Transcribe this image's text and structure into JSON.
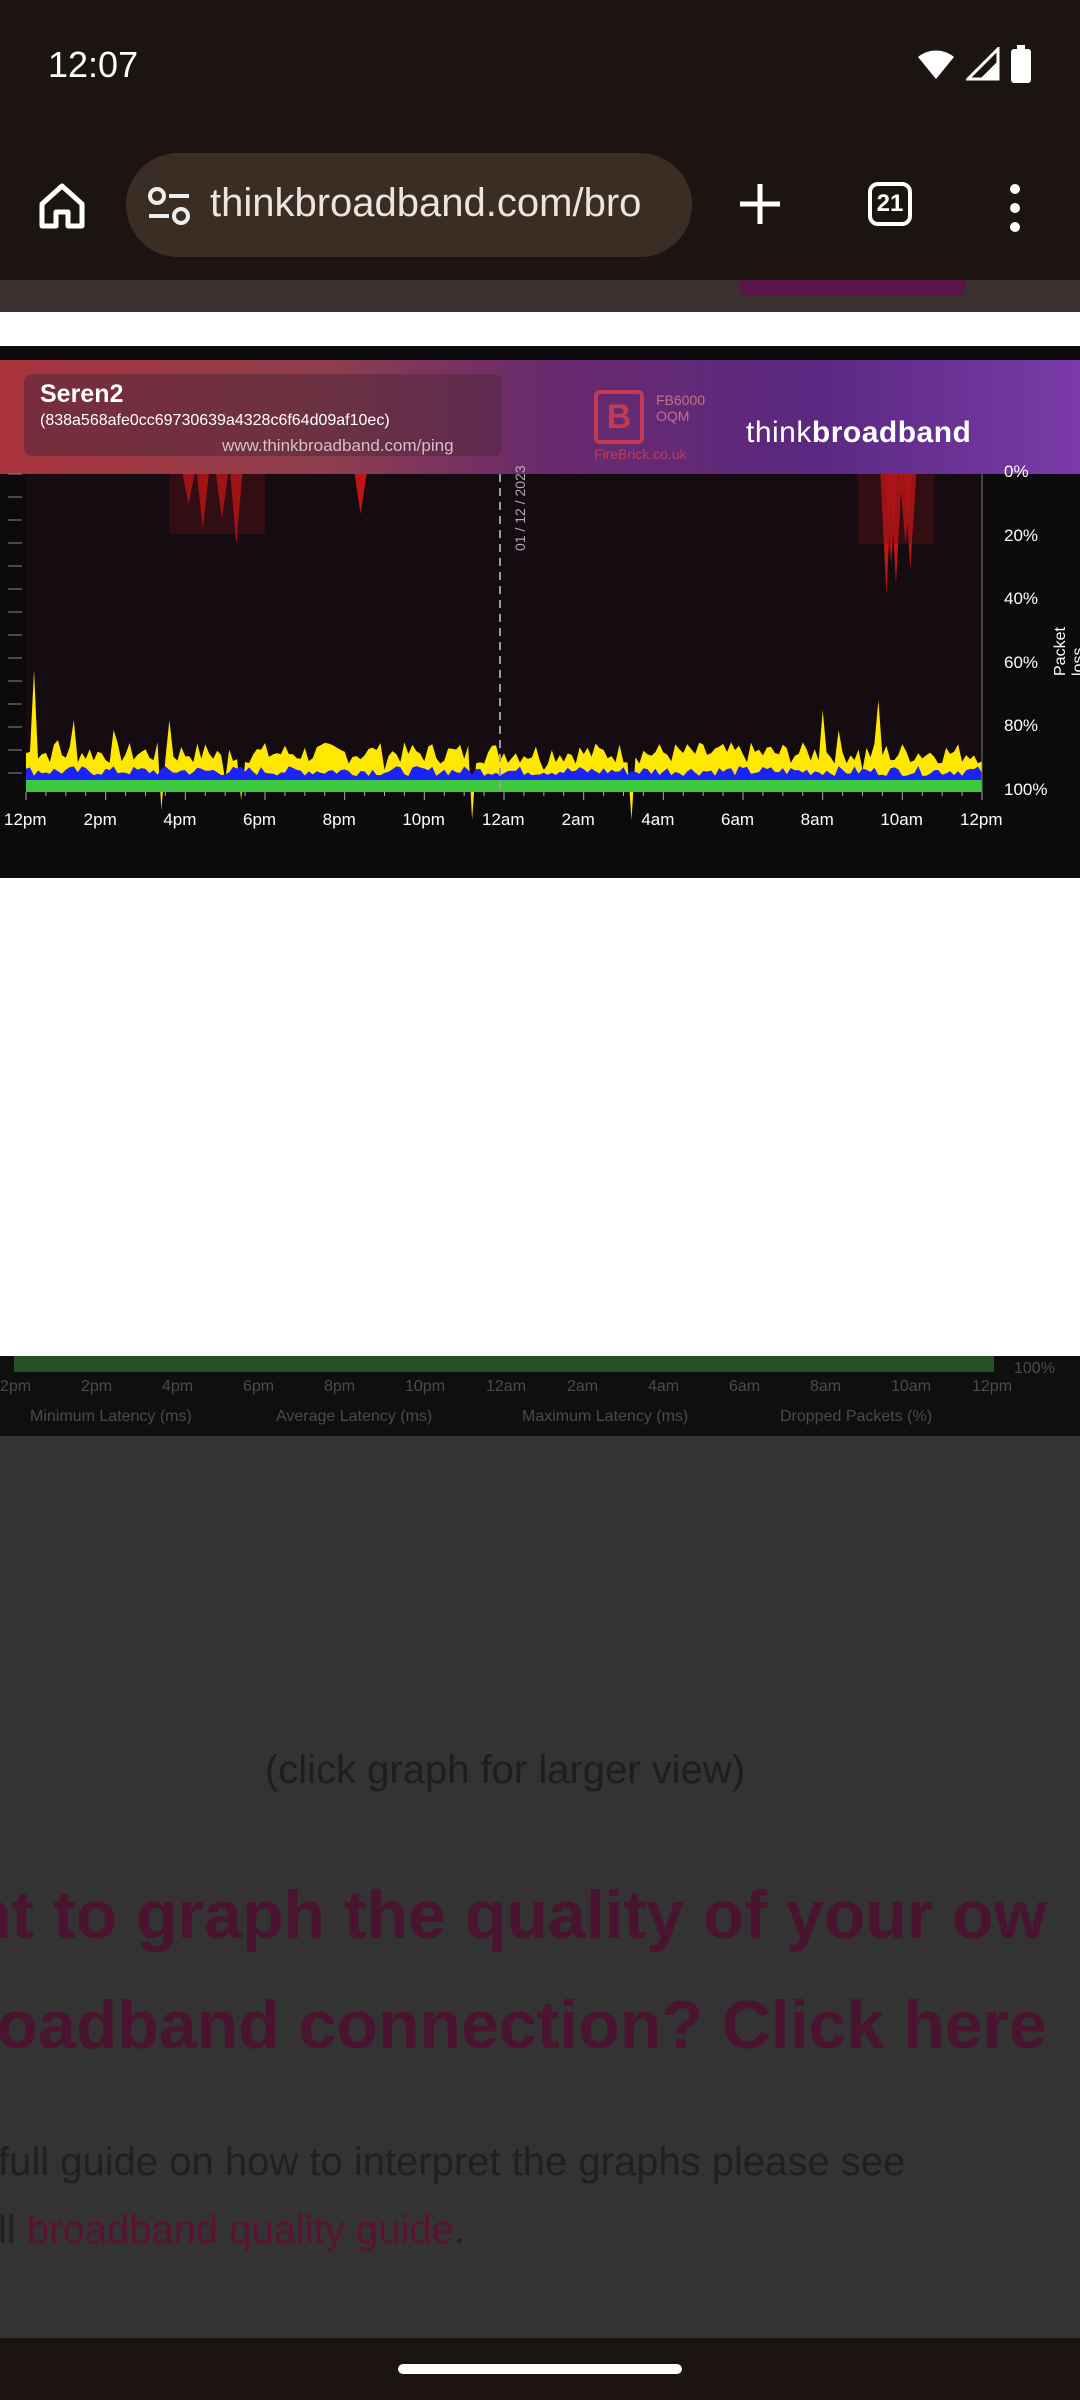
{
  "status": {
    "time": "12:07"
  },
  "browser": {
    "url": "thinkbroadband.com/bro",
    "tab_count": "21"
  },
  "graph": {
    "title": "Seren2",
    "id": "(838a568afe0cc69730639a4328c6f64d09af10ec)",
    "site": "www.thinkbroadband.com/ping",
    "firebrick_line1": "FB6000",
    "firebrick_line2": "OQM",
    "firebrick_site": "FireBrick.co.uk",
    "brand_prefix": "think",
    "brand_suffix": "broadband",
    "date": "01 / 12 / 2023",
    "x_ticks": [
      "12pm",
      "2pm",
      "4pm",
      "6pm",
      "8pm",
      "10pm",
      "12am",
      "2am",
      "4am",
      "6am",
      "8am",
      "10am",
      "12pm"
    ],
    "packet_ticks": [
      "0%",
      "20%",
      "40%",
      "60%",
      "80%",
      "100%"
    ],
    "packet_label": "Packet loss",
    "legend": [
      {
        "label": "Minimum Latency (ms)",
        "color": "#3cc83c"
      },
      {
        "label": "Average Latency (ms)",
        "color": "#1a1aff"
      },
      {
        "label": "Maximum Latency (ms)",
        "color": "#ffee00"
      },
      {
        "label": "Dropped Packets (%)",
        "color": "#e01010"
      }
    ]
  },
  "dim_graph": {
    "x_ticks": [
      "2pm",
      "2pm",
      "4pm",
      "6pm",
      "8pm",
      "10pm",
      "12am",
      "2am",
      "4am",
      "6am",
      "8am",
      "10am",
      "12pm"
    ],
    "pct": "100%",
    "legend": [
      "Minimum Latency (ms)",
      "Average Latency (ms)",
      "Maximum Latency (ms)",
      "Dropped Packets (%)"
    ]
  },
  "content": {
    "caption": "(click graph for larger view)",
    "headline_1": "nt to graph the quality of your ow",
    "headline_2": "roadband connection? Click here",
    "body_1": "full guide on how to interpret the graphs please see",
    "body_2_prefix": "ll ",
    "body_2_link": "broadband quality guide",
    "body_2_suffix": "."
  }
}
